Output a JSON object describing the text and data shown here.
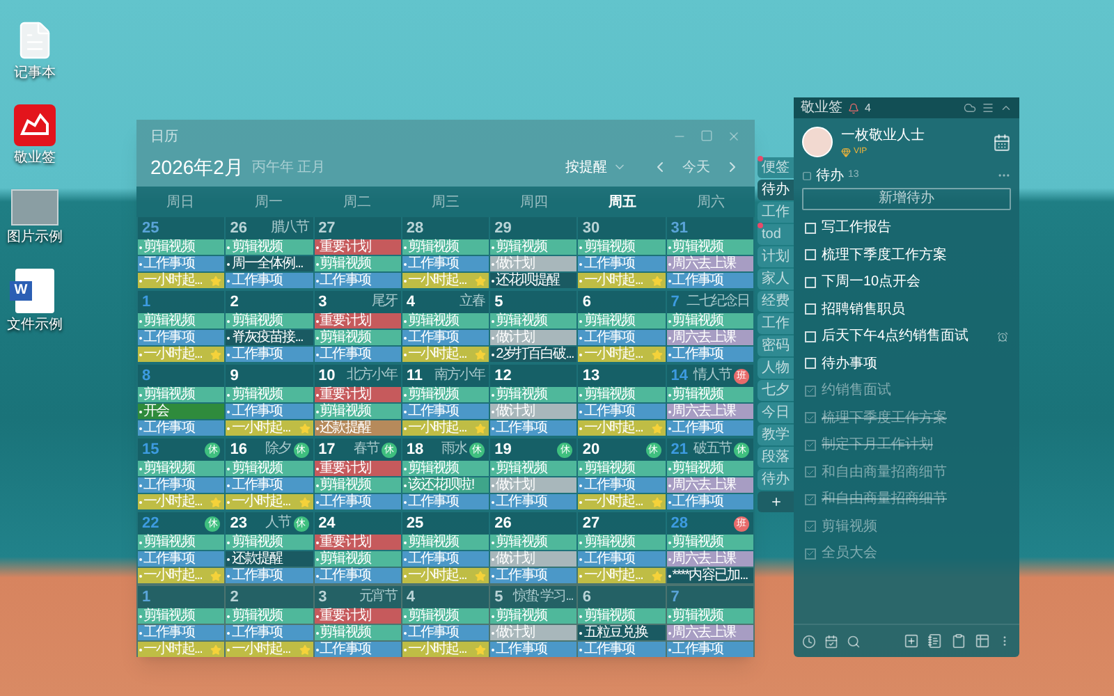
{
  "desktop_icons": [
    {
      "kind": "text-file",
      "label": "记事本"
    },
    {
      "kind": "app",
      "label": "敬业签"
    },
    {
      "kind": "image",
      "label": "图片示例"
    },
    {
      "kind": "word-document",
      "label": "文件示例",
      "glyph": "W"
    }
  ],
  "calendar": {
    "window_title": "日历",
    "month": "2026年2月",
    "lunar": "丙午年 正月",
    "filter": "按提醒",
    "today_button": "今天",
    "weekdays": [
      {
        "label": "周日",
        "selected": false
      },
      {
        "label": "周一",
        "selected": false
      },
      {
        "label": "周二",
        "selected": false
      },
      {
        "label": "周三",
        "selected": false
      },
      {
        "label": "周四",
        "selected": false
      },
      {
        "label": "周五",
        "selected": true
      },
      {
        "label": "周六",
        "selected": false
      }
    ],
    "weeks": [
      {
        "days": [
          {
            "date": "25",
            "muted": true,
            "events": [
              {
                "text": "剪辑视频",
                "color": "#4fb89b",
                "starred": false
              },
              {
                "text": "工作事项",
                "color": "#4b98c8",
                "starred": false
              },
              {
                "text": "一小时起...",
                "color": "#bfbd45",
                "starred": true
              }
            ]
          },
          {
            "date": "26",
            "muted": true,
            "label": "腊八节",
            "events": [
              {
                "text": "剪辑视频",
                "color": "#4fb89b",
                "starred": false
              },
              {
                "text": "周一全体例...",
                "color": "#1a5a62",
                "starred": false
              },
              {
                "text": "工作事项",
                "color": "#4b98c8",
                "starred": false
              }
            ]
          },
          {
            "date": "27",
            "muted": true,
            "events": [
              {
                "text": "重要计划",
                "color": "#c65a5c",
                "starred": false
              },
              {
                "text": "剪辑视频",
                "color": "#4fb89b",
                "starred": false
              },
              {
                "text": "工作事项",
                "color": "#4b98c8",
                "starred": false
              }
            ]
          },
          {
            "date": "28",
            "muted": true,
            "events": [
              {
                "text": "剪辑视频",
                "color": "#4fb89b",
                "starred": false
              },
              {
                "text": "工作事项",
                "color": "#4b98c8",
                "starred": false
              },
              {
                "text": "一小时起...",
                "color": "#bfbd45",
                "starred": true
              }
            ]
          },
          {
            "date": "29",
            "muted": true,
            "events": [
              {
                "text": "剪辑视频",
                "color": "#4fb89b",
                "starred": false
              },
              {
                "text": "做计划",
                "color": "#a8b7bb",
                "starred": false
              },
              {
                "text": "还花呗提醒",
                "color": "#1a5a62",
                "starred": false
              }
            ]
          },
          {
            "date": "30",
            "muted": true,
            "events": [
              {
                "text": "剪辑视频",
                "color": "#4fb89b",
                "starred": false
              },
              {
                "text": "工作事项",
                "color": "#4b98c8",
                "starred": false
              },
              {
                "text": "一小时起...",
                "color": "#bfbd45",
                "starred": true
              }
            ]
          },
          {
            "date": "31",
            "muted": true,
            "events": [
              {
                "text": "剪辑视频",
                "color": "#4fb89b",
                "starred": false
              },
              {
                "text": "周六去上课",
                "color": "#a79dc3",
                "starred": false
              },
              {
                "text": "工作事项",
                "color": "#4b98c8",
                "starred": false
              }
            ]
          }
        ]
      },
      {
        "days": [
          {
            "date": "1",
            "muted": false,
            "events": [
              {
                "text": "剪辑视频",
                "color": "#4fb89b",
                "starred": false
              },
              {
                "text": "工作事项",
                "color": "#4b98c8",
                "starred": false
              },
              {
                "text": "一小时起...",
                "color": "#bfbd45",
                "starred": true
              }
            ]
          },
          {
            "date": "2",
            "muted": false,
            "events": [
              {
                "text": "剪辑视频",
                "color": "#4fb89b",
                "starred": false
              },
              {
                "text": "脊灰疫苗接...",
                "color": "#1a5a62",
                "starred": false
              },
              {
                "text": "工作事项",
                "color": "#4b98c8",
                "starred": false
              }
            ]
          },
          {
            "date": "3",
            "muted": false,
            "label": "尾牙",
            "events": [
              {
                "text": "重要计划",
                "color": "#c65a5c",
                "starred": false
              },
              {
                "text": "剪辑视频",
                "color": "#4fb89b",
                "starred": false
              },
              {
                "text": "工作事项",
                "color": "#4b98c8",
                "starred": false
              }
            ]
          },
          {
            "date": "4",
            "muted": false,
            "label": "立春",
            "events": [
              {
                "text": "剪辑视频",
                "color": "#4fb89b",
                "starred": false
              },
              {
                "text": "工作事项",
                "color": "#4b98c8",
                "starred": false
              },
              {
                "text": "一小时起...",
                "color": "#bfbd45",
                "starred": true
              }
            ]
          },
          {
            "date": "5",
            "muted": false,
            "events": [
              {
                "text": "剪辑视频",
                "color": "#4fb89b",
                "starred": false
              },
              {
                "text": "做计划",
                "color": "#a8b7bb",
                "starred": false
              },
              {
                "text": "2岁打百白破...",
                "color": "#1a5a62",
                "starred": false
              }
            ]
          },
          {
            "date": "6",
            "muted": false,
            "events": [
              {
                "text": "剪辑视频",
                "color": "#4fb89b",
                "starred": false
              },
              {
                "text": "工作事项",
                "color": "#4b98c8",
                "starred": false
              },
              {
                "text": "一小时起...",
                "color": "#bfbd45",
                "starred": true
              }
            ]
          },
          {
            "date": "7",
            "muted": false,
            "label": "二七纪念日",
            "events": [
              {
                "text": "剪辑视频",
                "color": "#4fb89b",
                "starred": false
              },
              {
                "text": "周六去上课",
                "color": "#a79dc3",
                "starred": false
              },
              {
                "text": "工作事项",
                "color": "#4b98c8",
                "starred": false
              }
            ]
          }
        ]
      },
      {
        "days": [
          {
            "date": "8",
            "muted": false,
            "events": [
              {
                "text": "剪辑视频",
                "color": "#4fb89b",
                "starred": false
              },
              {
                "text": "开会",
                "color": "#2f8b3c",
                "starred": false
              },
              {
                "text": "工作事项",
                "color": "#4b98c8",
                "starred": false
              }
            ]
          },
          {
            "date": "9",
            "muted": false,
            "events": [
              {
                "text": "剪辑视频",
                "color": "#4fb89b",
                "starred": false
              },
              {
                "text": "工作事项",
                "color": "#4b98c8",
                "starred": false
              },
              {
                "text": "一小时起...",
                "color": "#bfbd45",
                "starred": true
              }
            ]
          },
          {
            "date": "10",
            "muted": false,
            "label": "北方小年",
            "events": [
              {
                "text": "重要计划",
                "color": "#c65a5c",
                "starred": false
              },
              {
                "text": "剪辑视频",
                "color": "#4fb89b",
                "starred": false
              },
              {
                "text": "还款提醒",
                "color": "#b68a5b",
                "starred": false
              }
            ]
          },
          {
            "date": "11",
            "muted": false,
            "label": "南方小年",
            "events": [
              {
                "text": "剪辑视频",
                "color": "#4fb89b",
                "starred": false
              },
              {
                "text": "工作事项",
                "color": "#4b98c8",
                "starred": false
              },
              {
                "text": "一小时起...",
                "color": "#bfbd45",
                "starred": true
              }
            ]
          },
          {
            "date": "12",
            "muted": false,
            "events": [
              {
                "text": "剪辑视频",
                "color": "#4fb89b",
                "starred": false
              },
              {
                "text": "做计划",
                "color": "#a8b7bb",
                "starred": false
              },
              {
                "text": "工作事项",
                "color": "#4b98c8",
                "starred": false
              }
            ]
          },
          {
            "date": "13",
            "muted": false,
            "events": [
              {
                "text": "剪辑视频",
                "color": "#4fb89b",
                "starred": false
              },
              {
                "text": "工作事项",
                "color": "#4b98c8",
                "starred": false
              },
              {
                "text": "一小时起...",
                "color": "#bfbd45",
                "starred": true
              }
            ]
          },
          {
            "date": "14",
            "muted": false,
            "label": "情人节",
            "badge": {
              "text": "班",
              "kind": "work"
            },
            "events": [
              {
                "text": "剪辑视频",
                "color": "#4fb89b",
                "starred": false
              },
              {
                "text": "周六去上课",
                "color": "#a79dc3",
                "starred": false
              },
              {
                "text": "工作事项",
                "color": "#4b98c8",
                "starred": false
              }
            ]
          }
        ]
      },
      {
        "days": [
          {
            "date": "15",
            "muted": false,
            "badge": {
              "text": "休",
              "kind": "rest"
            },
            "events": [
              {
                "text": "剪辑视频",
                "color": "#4fb89b",
                "starred": false
              },
              {
                "text": "工作事项",
                "color": "#4b98c8",
                "starred": false
              },
              {
                "text": "一小时起...",
                "color": "#bfbd45",
                "starred": true
              }
            ]
          },
          {
            "date": "16",
            "muted": false,
            "label": "除夕",
            "badge": {
              "text": "休",
              "kind": "rest"
            },
            "events": [
              {
                "text": "剪辑视频",
                "color": "#4fb89b",
                "starred": false
              },
              {
                "text": "工作事项",
                "color": "#4b98c8",
                "starred": false
              },
              {
                "text": "一小时起...",
                "color": "#bfbd45",
                "starred": true
              }
            ]
          },
          {
            "date": "17",
            "muted": false,
            "label": "春节",
            "badge": {
              "text": "休",
              "kind": "rest"
            },
            "events": [
              {
                "text": "重要计划",
                "color": "#c65a5c",
                "starred": false
              },
              {
                "text": "剪辑视频",
                "color": "#4fb89b",
                "starred": false
              },
              {
                "text": "工作事项",
                "color": "#4b98c8",
                "starred": false
              }
            ]
          },
          {
            "date": "18",
            "muted": false,
            "label": "雨水",
            "badge": {
              "text": "休",
              "kind": "rest"
            },
            "events": [
              {
                "text": "剪辑视频",
                "color": "#4fb89b",
                "starred": false
              },
              {
                "text": "该还花呗啦!",
                "color": "#3fa58a",
                "starred": false
              },
              {
                "text": "工作事项",
                "color": "#4b98c8",
                "starred": false
              }
            ]
          },
          {
            "date": "19",
            "muted": false,
            "badge": {
              "text": "休",
              "kind": "rest"
            },
            "events": [
              {
                "text": "剪辑视频",
                "color": "#4fb89b",
                "starred": false
              },
              {
                "text": "做计划",
                "color": "#a8b7bb",
                "starred": false
              },
              {
                "text": "工作事项",
                "color": "#4b98c8",
                "starred": false
              }
            ]
          },
          {
            "date": "20",
            "muted": false,
            "badge": {
              "text": "休",
              "kind": "rest"
            },
            "events": [
              {
                "text": "剪辑视频",
                "color": "#4fb89b",
                "starred": false
              },
              {
                "text": "工作事项",
                "color": "#4b98c8",
                "starred": false
              },
              {
                "text": "一小时起...",
                "color": "#bfbd45",
                "starred": true
              }
            ]
          },
          {
            "date": "21",
            "muted": false,
            "label": "破五节",
            "badge": {
              "text": "休",
              "kind": "rest"
            },
            "events": [
              {
                "text": "剪辑视频",
                "color": "#4fb89b",
                "starred": false
              },
              {
                "text": "周六去上课",
                "color": "#a79dc3",
                "starred": false
              },
              {
                "text": "工作事项",
                "color": "#4b98c8",
                "starred": false
              }
            ]
          }
        ]
      },
      {
        "days": [
          {
            "date": "22",
            "muted": false,
            "badge": {
              "text": "休",
              "kind": "rest"
            },
            "events": [
              {
                "text": "剪辑视频",
                "color": "#4fb89b",
                "starred": false
              },
              {
                "text": "工作事项",
                "color": "#4b98c8",
                "starred": false
              },
              {
                "text": "一小时起...",
                "color": "#bfbd45",
                "starred": true
              }
            ]
          },
          {
            "date": "23",
            "muted": false,
            "label": "人节",
            "badge": {
              "text": "休",
              "kind": "rest"
            },
            "events": [
              {
                "text": "剪辑视频",
                "color": "#4fb89b",
                "starred": false
              },
              {
                "text": "还款提醒",
                "color": "#1a5a62",
                "starred": false
              },
              {
                "text": "工作事项",
                "color": "#4b98c8",
                "starred": false
              }
            ]
          },
          {
            "date": "24",
            "muted": false,
            "events": [
              {
                "text": "重要计划",
                "color": "#c65a5c",
                "starred": false
              },
              {
                "text": "剪辑视频",
                "color": "#4fb89b",
                "starred": false
              },
              {
                "text": "工作事项",
                "color": "#4b98c8",
                "starred": false
              }
            ]
          },
          {
            "date": "25",
            "muted": false,
            "events": [
              {
                "text": "剪辑视频",
                "color": "#4fb89b",
                "starred": false
              },
              {
                "text": "工作事项",
                "color": "#4b98c8",
                "starred": false
              },
              {
                "text": "一小时起...",
                "color": "#bfbd45",
                "starred": true
              }
            ]
          },
          {
            "date": "26",
            "muted": false,
            "events": [
              {
                "text": "剪辑视频",
                "color": "#4fb89b",
                "starred": false
              },
              {
                "text": "做计划",
                "color": "#a8b7bb",
                "starred": false
              },
              {
                "text": "工作事项",
                "color": "#4b98c8",
                "starred": false
              }
            ]
          },
          {
            "date": "27",
            "muted": false,
            "events": [
              {
                "text": "剪辑视频",
                "color": "#4fb89b",
                "starred": false
              },
              {
                "text": "工作事项",
                "color": "#4b98c8",
                "starred": false
              },
              {
                "text": "一小时起...",
                "color": "#bfbd45",
                "starred": true
              }
            ]
          },
          {
            "date": "28",
            "muted": false,
            "badge": {
              "text": "班",
              "kind": "work"
            },
            "events": [
              {
                "text": "剪辑视频",
                "color": "#4fb89b",
                "starred": false
              },
              {
                "text": "周六去上课",
                "color": "#a79dc3",
                "starred": false
              },
              {
                "text": "****内容已加...",
                "color": "#1a5a62",
                "starred": false
              }
            ]
          }
        ]
      },
      {
        "days": [
          {
            "date": "1",
            "muted": true,
            "events": [
              {
                "text": "剪辑视频",
                "color": "#4fb89b",
                "starred": false
              },
              {
                "text": "工作事项",
                "color": "#4b98c8",
                "starred": false
              },
              {
                "text": "一小时起...",
                "color": "#bfbd45",
                "starred": true
              }
            ]
          },
          {
            "date": "2",
            "muted": true,
            "events": [
              {
                "text": "剪辑视频",
                "color": "#4fb89b",
                "starred": false
              },
              {
                "text": "工作事项",
                "color": "#4b98c8",
                "starred": false
              },
              {
                "text": "一小时起...",
                "color": "#bfbd45",
                "starred": true
              }
            ]
          },
          {
            "date": "3",
            "muted": true,
            "label": "元宵节",
            "events": [
              {
                "text": "重要计划",
                "color": "#c65a5c",
                "starred": false
              },
              {
                "text": "剪辑视频",
                "color": "#4fb89b",
                "starred": false
              },
              {
                "text": "工作事项",
                "color": "#4b98c8",
                "starred": false
              }
            ]
          },
          {
            "date": "4",
            "muted": true,
            "events": [
              {
                "text": "剪辑视频",
                "color": "#4fb89b",
                "starred": false
              },
              {
                "text": "工作事项",
                "color": "#4b98c8",
                "starred": false
              },
              {
                "text": "一小时起...",
                "color": "#bfbd45",
                "starred": true
              }
            ]
          },
          {
            "date": "5",
            "muted": true,
            "label": "惊蛰 学习...",
            "events": [
              {
                "text": "剪辑视频",
                "color": "#4fb89b",
                "starred": false
              },
              {
                "text": "做计划",
                "color": "#a8b7bb",
                "starred": false
              },
              {
                "text": "工作事项",
                "color": "#4b98c8",
                "starred": false
              }
            ]
          },
          {
            "date": "6",
            "muted": true,
            "events": [
              {
                "text": "剪辑视频",
                "color": "#4fb89b",
                "starred": false
              },
              {
                "text": "五粒豆兑换",
                "color": "#1a5a62",
                "starred": false
              },
              {
                "text": "工作事项",
                "color": "#4b98c8",
                "starred": false
              }
            ]
          },
          {
            "date": "7",
            "muted": true,
            "events": [
              {
                "text": "剪辑视频",
                "color": "#4fb89b",
                "starred": false
              },
              {
                "text": "周六去上课",
                "color": "#a79dc3",
                "starred": false
              },
              {
                "text": "工作事项",
                "color": "#4b98c8",
                "starred": false
              }
            ]
          }
        ]
      }
    ]
  },
  "notes": {
    "app_title": "敬业签",
    "notifications": "4",
    "user_name": "一枚敬业人士",
    "vip": "VIP",
    "tabs": [
      {
        "label": "便签",
        "selected": false,
        "unread": true
      },
      {
        "label": "待办",
        "selected": true,
        "unread": false
      },
      {
        "label": "工作",
        "selected": false,
        "unread": false
      },
      {
        "label": "tod",
        "selected": false,
        "unread": true
      },
      {
        "label": "计划",
        "selected": false,
        "unread": false
      },
      {
        "label": "家人",
        "selected": false,
        "unread": false
      },
      {
        "label": "经费",
        "selected": false,
        "unread": false
      },
      {
        "label": "工作",
        "selected": false,
        "unread": false
      },
      {
        "label": "密码",
        "selected": false,
        "unread": false
      },
      {
        "label": "人物",
        "selected": false,
        "unread": false
      },
      {
        "label": "七夕",
        "selected": false,
        "unread": false
      },
      {
        "label": "今日",
        "selected": false,
        "unread": false
      },
      {
        "label": "教学",
        "selected": false,
        "unread": false
      },
      {
        "label": "段落",
        "selected": false,
        "unread": false
      },
      {
        "label": "待办",
        "selected": false,
        "unread": false
      }
    ],
    "section_title": "待办",
    "section_count": "13",
    "new_button": "新增待办",
    "items": [
      {
        "text": "写工作报告",
        "checked": false,
        "struck": false,
        "reminder": false
      },
      {
        "text": "梳理下季度工作方案",
        "checked": false,
        "struck": false,
        "reminder": false
      },
      {
        "text": "下周一10点开会",
        "checked": false,
        "struck": false,
        "reminder": false
      },
      {
        "text": "招聘销售职员",
        "checked": false,
        "struck": false,
        "reminder": false
      },
      {
        "text": "后天下午4点约销售面试",
        "checked": false,
        "struck": false,
        "reminder": true
      },
      {
        "text": "待办事项",
        "checked": false,
        "struck": false,
        "reminder": false
      },
      {
        "text": "约销售面试",
        "checked": true,
        "struck": false,
        "reminder": false
      },
      {
        "text": "梳理下季度工作方案",
        "checked": true,
        "struck": true,
        "reminder": false
      },
      {
        "text": "制定下月工作计划",
        "checked": true,
        "struck": true,
        "reminder": false
      },
      {
        "text": "和自由商量招商细节",
        "checked": true,
        "struck": false,
        "reminder": false
      },
      {
        "text": "和自由商量招商细节",
        "checked": true,
        "struck": true,
        "reminder": false
      },
      {
        "text": "剪辑视频",
        "checked": true,
        "struck": false,
        "reminder": false
      },
      {
        "text": "全员大会",
        "checked": true,
        "struck": false,
        "reminder": false
      }
    ]
  }
}
